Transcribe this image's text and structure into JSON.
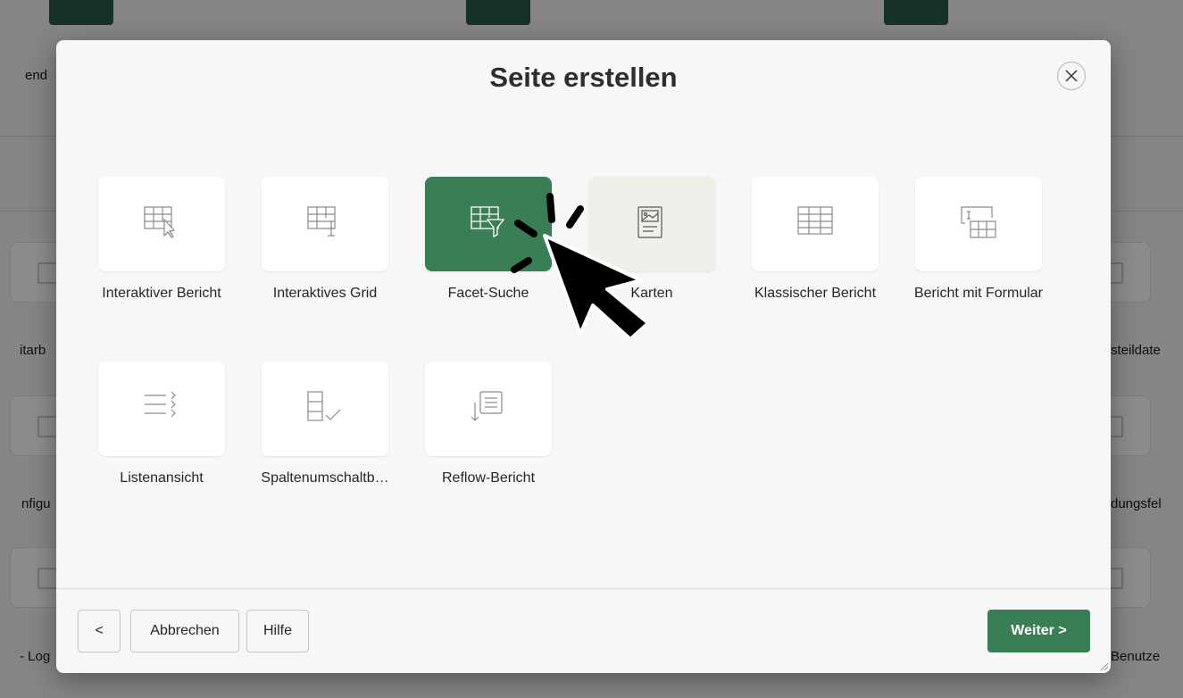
{
  "dialog": {
    "title": "Seite erstellen",
    "close_icon": "close-icon"
  },
  "page_types": [
    {
      "label": "Interaktiver Bericht",
      "icon": "interactive-report-icon",
      "state": "normal"
    },
    {
      "label": "Interaktives Grid",
      "icon": "interactive-grid-icon",
      "state": "normal"
    },
    {
      "label": "Facet-Suche",
      "icon": "faceted-search-icon",
      "state": "selected"
    },
    {
      "label": "Karten",
      "icon": "cards-icon",
      "state": "hover"
    },
    {
      "label": "Klassischer Bericht",
      "icon": "classic-report-icon",
      "state": "normal"
    },
    {
      "label": "Bericht mit Formular",
      "icon": "report-with-form-icon",
      "state": "normal"
    },
    {
      "label": "Listenansicht",
      "icon": "list-view-icon",
      "state": "normal"
    },
    {
      "label": "Spaltenumschaltb…",
      "icon": "column-toggle-report-icon",
      "state": "normal"
    },
    {
      "label": "Reflow-Bericht",
      "icon": "reflow-report-icon",
      "state": "normal"
    }
  ],
  "footer": {
    "back_label": "<",
    "cancel_label": "Abbrechen",
    "help_label": "Hilfe",
    "next_label": "Weiter >"
  },
  "background": {
    "fragments": [
      "end",
      "itarb",
      "nfigu",
      "- Log",
      "steildate",
      "dungsfel",
      "Benutze"
    ]
  },
  "colors": {
    "accent": "#3a7e55",
    "hover_tile": "#f0efea"
  }
}
